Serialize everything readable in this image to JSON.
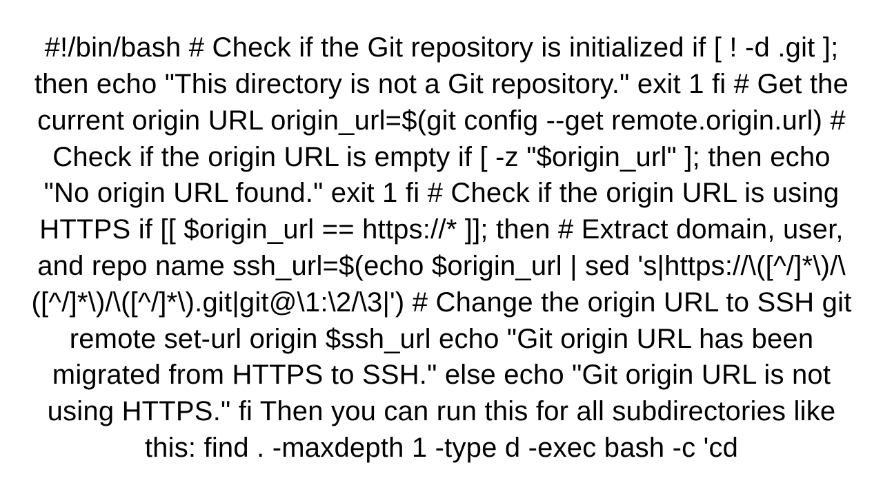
{
  "document": {
    "text": "#!/bin/bash  # Check if the Git repository is initialized if [ ! -d .git ]; then   echo \"This directory is not a Git repository.\"   exit 1 fi  # Get the current origin URL origin_url=$(git config --get remote.origin.url)  # Check if the origin URL is empty if [ -z \"$origin_url\" ]; then   echo \"No origin URL found.\"   exit 1 fi  # Check if the origin URL is using HTTPS if [[ $origin_url == https://* ]]; then   # Extract domain, user, and repo name   ssh_url=$(echo $origin_url | sed 's|https://\\([^/]*\\)/\\([^/]*\\)/\\([^/]*\\).git|git@\\1:\\2/\\3|')    # Change the origin URL to SSH   git remote set-url origin $ssh_url    echo \"Git origin URL has been migrated from HTTPS to SSH.\" else   echo \"Git origin URL is not using HTTPS.\" fi  Then you can run this for all subdirectories like this: find . -maxdepth 1 -type d -exec bash -c 'cd"
  }
}
